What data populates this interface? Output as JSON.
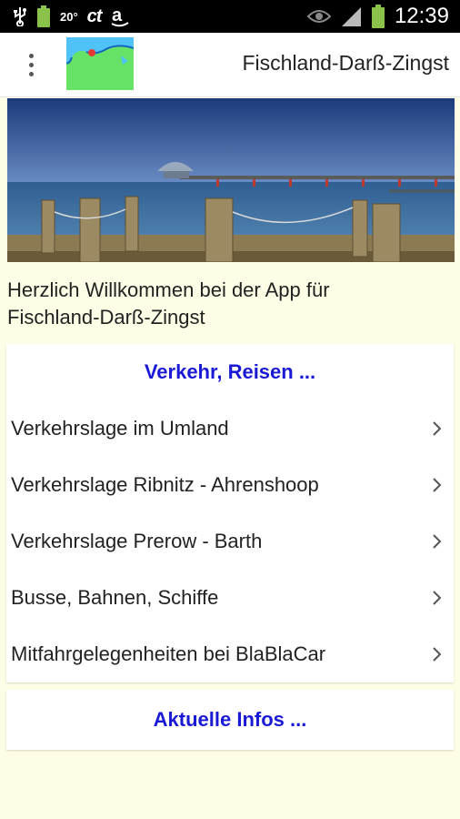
{
  "status_bar": {
    "temperature": "20°",
    "ct_label": "ct",
    "time": "12:39",
    "icons": [
      "usb-icon",
      "battery-icon",
      "ct-icon",
      "amazon-icon",
      "eye-icon",
      "signal-icon",
      "battery-icon"
    ]
  },
  "action_bar": {
    "title": "Fischland-Darß-Zingst",
    "logo_icon": "map-logo-icon",
    "menu_icon": "overflow-menu-icon"
  },
  "welcome": {
    "line1": "Herzlich Willkommen bei der App für",
    "line2": "Fischland-Darß-Zingst"
  },
  "section_traffic": {
    "header": "Verkehr, Reisen ...",
    "items": [
      {
        "label": "Verkehrslage im Umland"
      },
      {
        "label": "Verkehrslage Ribnitz - Ahrenshoop"
      },
      {
        "label": "Verkehrslage Prerow - Barth"
      },
      {
        "label": "Busse, Bahnen, Schiffe"
      },
      {
        "label": "Mitfahrgelegenheiten bei BlaBlaCar"
      }
    ]
  },
  "section_info": {
    "header": "Aktuelle Infos ..."
  },
  "colors": {
    "background": "#fefde6",
    "link_blue": "#1a1ad6",
    "status_bar": "#000000",
    "battery_green": "#8bc34a"
  }
}
